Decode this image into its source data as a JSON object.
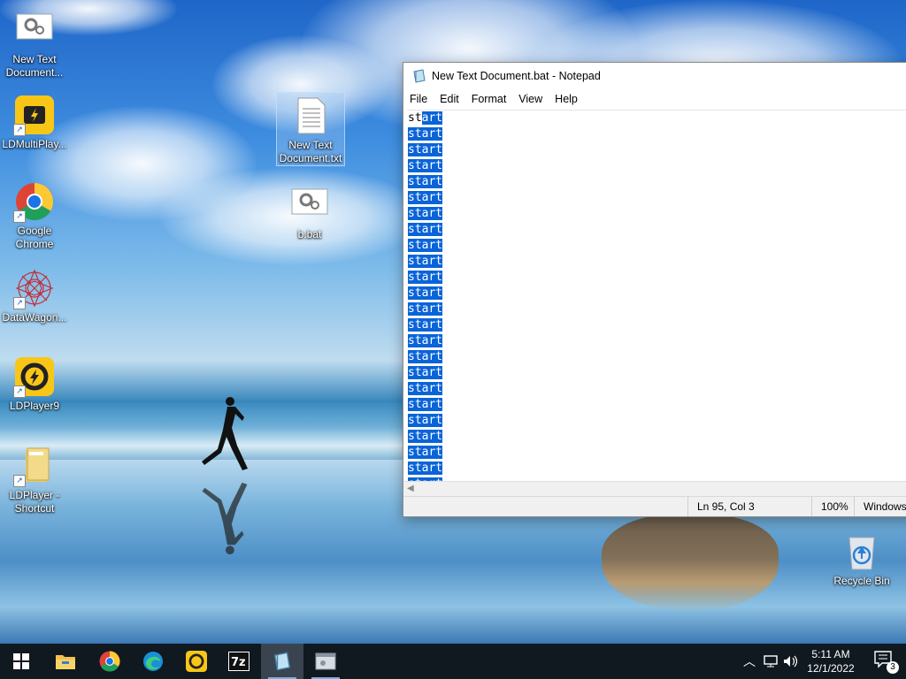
{
  "desktop": {
    "icons": [
      {
        "label": "New Text Document...",
        "name": "new-text-document-bat-icon"
      },
      {
        "label": "LDMultiPlay...",
        "name": "ldmultiplayer-icon"
      },
      {
        "label": "Google Chrome",
        "name": "google-chrome-icon"
      },
      {
        "label": "DataWagon...",
        "name": "datawagon-icon"
      },
      {
        "label": "LDPlayer9",
        "name": "ldplayer9-icon"
      },
      {
        "label": "LDPlayer - Shortcut",
        "name": "ldplayer-shortcut-icon"
      },
      {
        "label": "New Text Document.txt",
        "name": "new-text-document-txt-icon"
      },
      {
        "label": "b.bat",
        "name": "b-bat-icon"
      },
      {
        "label": "Recycle Bin",
        "name": "recycle-bin-icon"
      }
    ]
  },
  "notepad": {
    "title": "New Text Document.bat - Notepad",
    "menu": [
      "File",
      "Edit",
      "Format",
      "View",
      "Help"
    ],
    "first_line_unselected": "st",
    "first_line_selected": "art",
    "line_text": "start",
    "status": {
      "position": "Ln 95, Col 3",
      "zoom": "100%",
      "encoding": "Windows"
    }
  },
  "taskbar": {
    "time": "5:11 AM",
    "date": "12/1/2022",
    "notification_count": "3"
  },
  "colors": {
    "selection": "#0a64d8",
    "taskbar": "#101820"
  }
}
